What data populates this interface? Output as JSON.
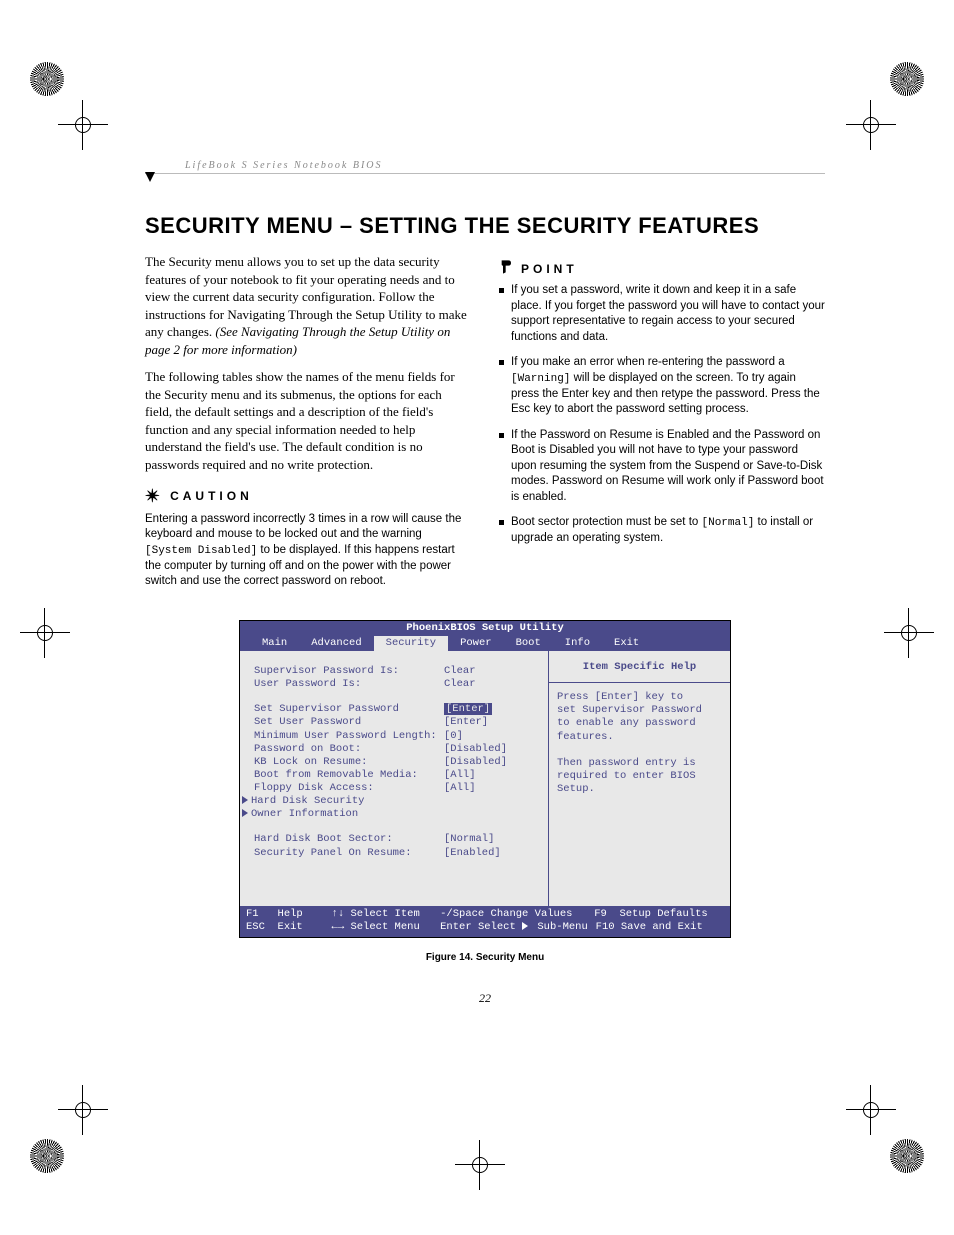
{
  "header": {
    "running": "LifeBook S Series Notebook BIOS"
  },
  "title": "SECURITY MENU – SETTING THE SECURITY FEATURES",
  "intro1a": "The Security menu allows you to set up the data security features of your notebook to fit your operating needs and to view the current data security configuration. Follow the instructions for Navigating Through the Setup Utility to make any changes. ",
  "intro1b": "(See Navigating Through the Setup Utility on page 2 for more information)",
  "intro2": "The following tables show the names of the menu fields for the Security menu and its submenus, the options for each field, the default settings and a description of the field's function and any special information needed to help understand the field's use. The default condition is no passwords required and no write protection.",
  "caution": {
    "label": "CAUTION",
    "pre": "Entering a password incorrectly 3 times in a row will cause the keyboard and mouse to be locked out and the warning ",
    "code": "[System Disabled]",
    "post": " to be displayed. If this happens restart the computer by turning off and on the power with the power switch and use the correct password on reboot."
  },
  "point": {
    "label": "POINT",
    "items": [
      {
        "text": "If you set a password, write it down and keep it in a safe place. If you forget the password you will have to contact your support representative to regain access to your secured functions and data."
      },
      {
        "pre": "If you make an error when re-entering the password a ",
        "code": "[Warning]",
        "post": " will be displayed on the screen. To try again press the Enter key and then retype the password. Press the Esc key to abort the password setting process."
      },
      {
        "text": "If the Password on Resume is Enabled and the Password on Boot is Disabled you will not have to type your password upon resuming the system from the Suspend or Save-to-Disk modes. Password on Resume will work only if Password boot is enabled."
      },
      {
        "pre": "Boot sector protection must be set to ",
        "code": "[Normal]",
        "post": " to install or upgrade an operating system."
      }
    ]
  },
  "bios": {
    "title": "PhoenixBIOS Setup Utility",
    "tabs": [
      "Main",
      "Advanced",
      "Security",
      "Power",
      "Boot",
      "Info",
      "Exit"
    ],
    "activeTab": "Security",
    "help": {
      "title": "Item Specific Help",
      "lines": [
        "Press [Enter] key to",
        "set Supervisor Password",
        "to enable any password",
        "features.",
        "",
        "Then password entry is",
        "required to enter BIOS",
        "Setup."
      ]
    },
    "rows": [
      {
        "label": "Supervisor Password Is:",
        "value": "Clear"
      },
      {
        "label": "User Password Is:",
        "value": "Clear"
      },
      {
        "spacer": true
      },
      {
        "label": "Set Supervisor Password",
        "value": "[Enter]",
        "selected": true
      },
      {
        "label": "Set User Password",
        "value": "[Enter]"
      },
      {
        "label": "Minimum User Password Length:",
        "value": "[0]"
      },
      {
        "label": "Password on Boot:",
        "value": "[Disabled]"
      },
      {
        "label": "KB Lock on Resume:",
        "value": "[Disabled]"
      },
      {
        "label": "Boot from Removable Media:",
        "value": "[All]"
      },
      {
        "label": "Floppy Disk Access:",
        "value": "[All]"
      },
      {
        "label": "Hard Disk Security",
        "submenu": true
      },
      {
        "label": "Owner Information",
        "submenu": true
      },
      {
        "spacer": true
      },
      {
        "label": "Hard Disk Boot Sector:",
        "value": "[Normal]"
      },
      {
        "label": "Security Panel On Resume:",
        "value": "[Enabled]"
      }
    ],
    "foot": {
      "r1": {
        "k1": "F1",
        "v1": "Help",
        "k2": "↑↓",
        "v2": "Select Item",
        "k3": "-/Space",
        "v3": "Change Values",
        "k4": "F9",
        "v4": "Setup Defaults"
      },
      "r2": {
        "k1": "ESC",
        "v1": "Exit",
        "k2": "←→",
        "v2": "Select Menu",
        "k3": "Enter",
        "v3a": "Select ",
        "v3b": " Sub-Menu",
        "k4": "F10",
        "v4": "Save and Exit"
      }
    }
  },
  "caption": "Figure 14.  Security Menu",
  "pageNumber": "22"
}
